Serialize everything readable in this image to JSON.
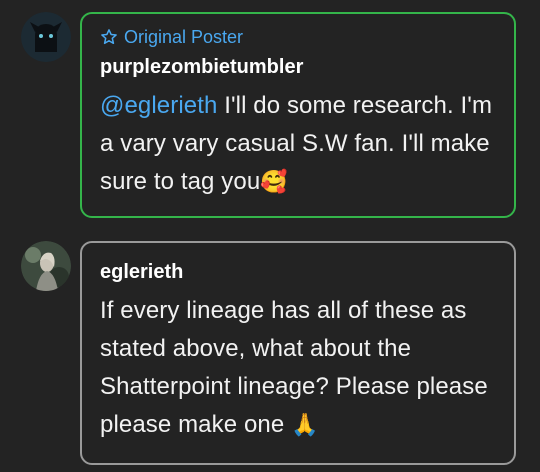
{
  "comments": [
    {
      "badge": "Original Poster",
      "username": "purplezombietumbler",
      "mention": "@eglerieth",
      "text_after_mention": " I'll do some research. I'm a vary vary casual S.W fan. I'll make sure to tag you",
      "emoji": "🥰",
      "border_color": "#34b54a"
    },
    {
      "username": "eglerieth",
      "text": "If every lineage has all of these as stated above, what about the Shatterpoint lineage? Please please please make one ",
      "emoji": "🙏",
      "border_color": "#9a9a9a"
    }
  ],
  "accent_color": "#4aa8f0"
}
